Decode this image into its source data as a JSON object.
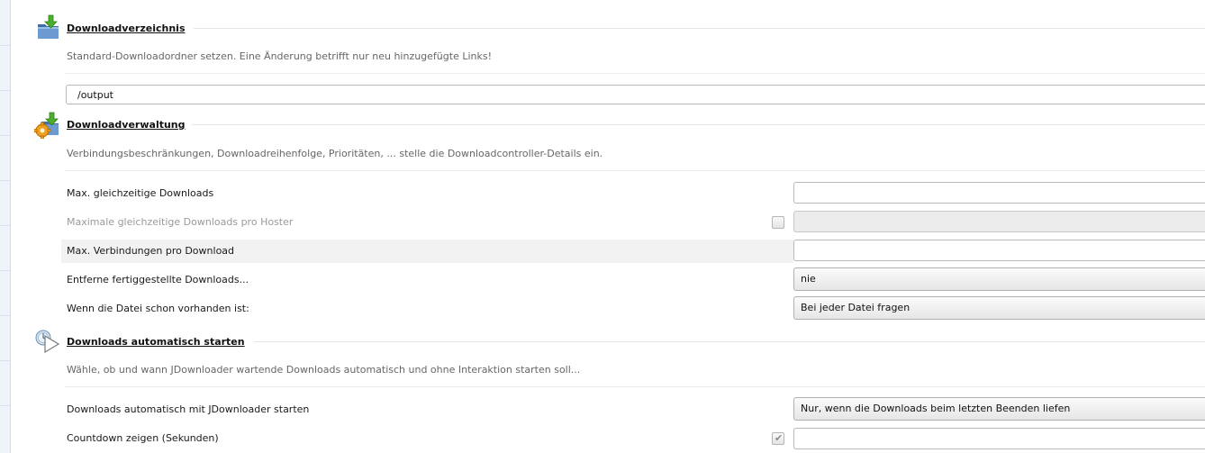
{
  "sections": [
    {
      "icon": "download-folder-icon",
      "title": "Downloadverzeichnis",
      "description": "Standard-Downloadordner setzen. Eine Änderung betrifft nur neu hinzugefügte Links!",
      "path_value": "/output"
    },
    {
      "icon": "download-manager-gear-icon",
      "title": "Downloadverwaltung",
      "description": "Verbindungsbeschränkungen, Downloadreihenfolge, Prioritäten, ... stelle die Downloadcontroller-Details ein.",
      "rows": [
        {
          "label": "Max. gleichzeitige Downloads",
          "value": ""
        },
        {
          "label": "Maximale gleichzeitige Downloads pro Hoster",
          "value": "",
          "checked": false,
          "disabled": true
        },
        {
          "label": "Max. Verbindungen pro Download",
          "value": ""
        },
        {
          "label": "Entferne fertiggestellte Downloads...",
          "selected": "nie"
        },
        {
          "label": "Wenn die Datei schon vorhanden ist:",
          "selected": "Bei jeder Datei fragen"
        }
      ]
    },
    {
      "icon": "auto-start-play-icon",
      "title": "Downloads automatisch starten",
      "description": "Wähle, ob und wann JDownloader wartende Downloads automatisch und ohne Interaktion starten soll...",
      "rows": [
        {
          "label": "Downloads automatisch mit JDownloader starten",
          "selected": "Nur, wenn die Downloads beim letzten Beenden liefen"
        },
        {
          "label": "Countdown zeigen (Sekunden)",
          "value": "",
          "checked": true
        }
      ]
    }
  ],
  "colors": {
    "highlight_row": "#f2f2f2",
    "folder_blue": "#4a7fb8",
    "arrow_green": "#4caf2e",
    "gear_orange": "#f0a020"
  }
}
